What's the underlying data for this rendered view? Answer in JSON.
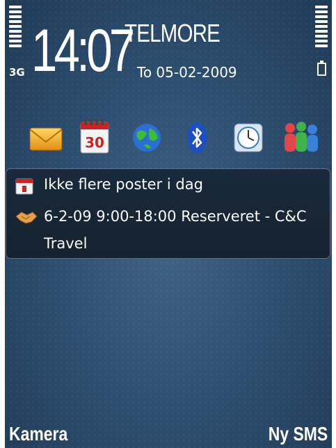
{
  "status": {
    "network_type": "3G",
    "signal_level": 1.0,
    "battery_level": 1.0
  },
  "idle": {
    "clock": "14:07",
    "operator": "TELMORE",
    "date": "To 05-02-2009"
  },
  "shortcuts": [
    {
      "name": "messaging",
      "icon": "envelope-icon"
    },
    {
      "name": "calendar",
      "icon": "calendar-icon",
      "label": "30"
    },
    {
      "name": "web",
      "icon": "globe-icon"
    },
    {
      "name": "bluetooth",
      "icon": "bluetooth-icon"
    },
    {
      "name": "clock",
      "icon": "clock-icon"
    },
    {
      "name": "contacts",
      "icon": "contacts-icon"
    }
  ],
  "calendar_panel": {
    "line1": "Ikke flere poster i dag",
    "line2": "6-2-09 9:00-18:00 Reserveret  - C&C",
    "line3": "Travel"
  },
  "softkeys": {
    "left": "Kamera",
    "right": "Ny SMS"
  },
  "colors": {
    "background": "#2f5072",
    "panel": "#1a2a3b",
    "text": "#ffffff"
  }
}
